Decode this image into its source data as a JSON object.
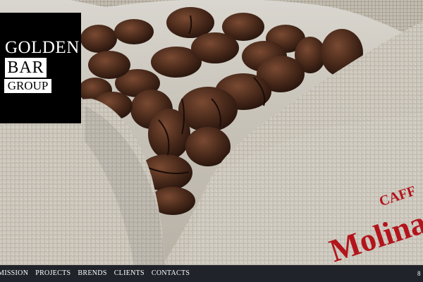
{
  "brand": {
    "line1": "GOLDEN",
    "line2": "BAR",
    "line3": "GROUP"
  },
  "nav": {
    "items": [
      "MISSION",
      "PROJECTS",
      "BRENDS",
      "CLIENTS",
      "CONTACTS"
    ],
    "right_fragment": "8"
  },
  "sack": {
    "print_top": "CAFF",
    "print_main": "Molinar"
  },
  "colors": {
    "nav_bg": "#20242a",
    "logo_bg": "#000000",
    "print_red": "#b3141c",
    "bean_dark": "#3d2418",
    "burlap": "#cfcac0"
  }
}
